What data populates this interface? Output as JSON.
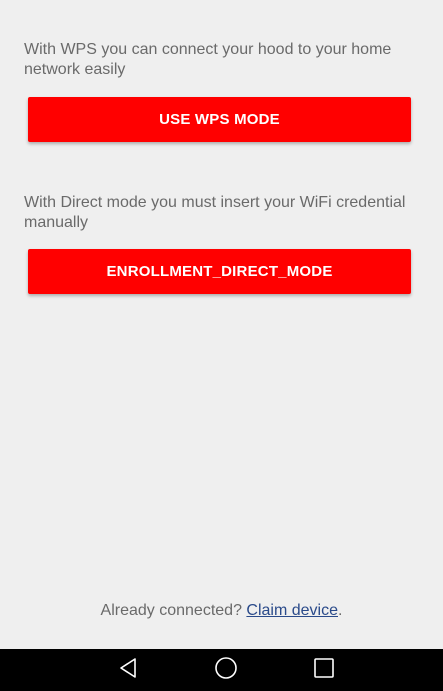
{
  "wps": {
    "description": "With WPS you can connect your hood to your home network easily",
    "button_label": "USE WPS MODE"
  },
  "direct": {
    "description": "With Direct mode you must insert your WiFi credential manually",
    "button_label": "ENROLLMENT_DIRECT_MODE"
  },
  "footer": {
    "prefix": "Already connected? ",
    "link_label": "Claim device",
    "suffix": "."
  },
  "navbar": {
    "icons": [
      "back-icon",
      "home-icon",
      "recent-apps-icon"
    ]
  },
  "colors": {
    "accent": "#ff0000",
    "background": "#efefef",
    "text": "#6a6a6a",
    "link": "#2a4a8a",
    "navbar": "#000000"
  }
}
